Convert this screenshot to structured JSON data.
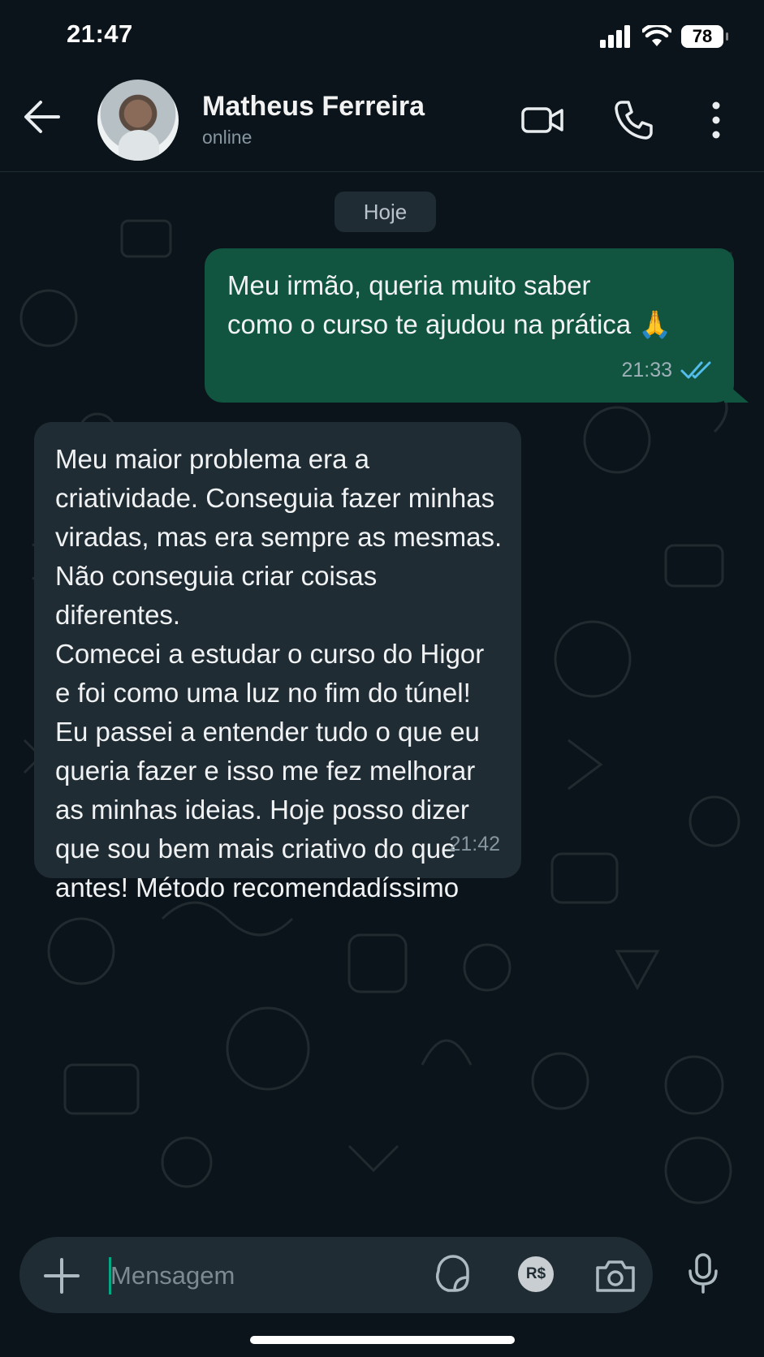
{
  "status_bar": {
    "time": "21:47",
    "battery": "78"
  },
  "header": {
    "contact_name": "Matheus Ferreira",
    "contact_status": "online"
  },
  "chat": {
    "date_separator": "Hoje",
    "messages": [
      {
        "direction": "outgoing",
        "text": "Meu irmão, queria muito saber\ncomo o curso te ajudou na prática 🙏",
        "time": "21:33",
        "read": true
      },
      {
        "direction": "incoming",
        "text": "Meu maior problema era a\ncriatividade. Conseguia fazer minhas\nviradas, mas era sempre as mesmas.\nNão conseguia criar coisas diferentes.\nComecei a estudar o curso do Higor\ne foi como uma luz no fim do túnel!\nEu passei a entender tudo o que eu\nqueria fazer e isso me fez melhorar\nas minhas ideias. Hoje posso dizer\nque sou bem mais criativo do que\nantes! Método recomendadíssimo",
        "time": "21:42"
      }
    ]
  },
  "composer": {
    "placeholder": "Mensagem",
    "pay_label": "R$"
  },
  "colors": {
    "background": "#0b141a",
    "outgoing_bubble": "#11543f",
    "incoming_bubble": "#202c33",
    "read_ticks": "#53bdeb",
    "accent": "#00a884"
  },
  "icons": [
    "back-arrow-icon",
    "video-call-icon",
    "phone-icon",
    "more-options-icon",
    "plus-icon",
    "sticker-icon",
    "payment-icon",
    "camera-icon",
    "mic-icon",
    "double-check-icon",
    "signal-icon",
    "wifi-icon",
    "battery-icon"
  ]
}
